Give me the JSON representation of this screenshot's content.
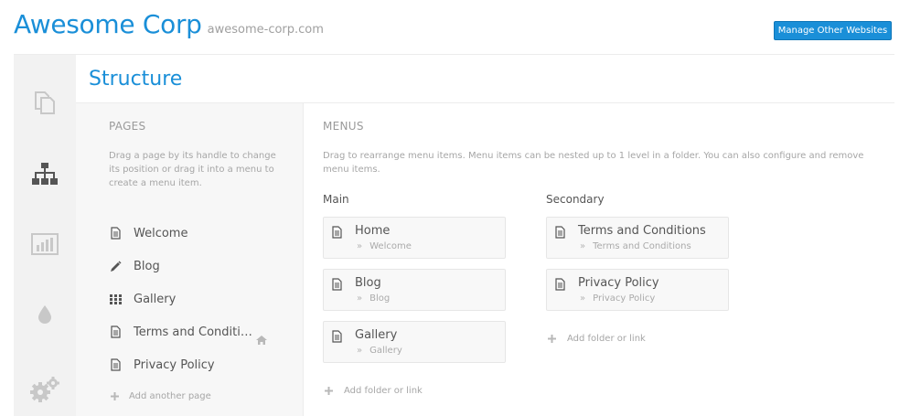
{
  "header": {
    "brand_title": "Awesome Corp",
    "brand_domain": "awesome-corp.com",
    "manage_button": "Manage Other Websites"
  },
  "colors": {
    "accent": "#1a8fd8",
    "sidebar_bg": "#f2f2f2",
    "icon": "#c8c8c8",
    "active_icon": "#555555"
  },
  "sidebar": {
    "items": [
      {
        "icon": "pages-icon",
        "active": false
      },
      {
        "icon": "sitemap-icon",
        "active": true
      },
      {
        "icon": "stats-icon",
        "active": false
      },
      {
        "icon": "droplet-icon",
        "active": false
      },
      {
        "icon": "gears-icon",
        "active": false
      }
    ]
  },
  "main": {
    "title": "Structure"
  },
  "pages": {
    "heading": "PAGES",
    "hint": "Drag a page by its handle to change its position or drag it into a menu to create a menu item.",
    "items": [
      {
        "label": "Welcome",
        "icon": "document-icon",
        "is_home": true
      },
      {
        "label": "Blog",
        "icon": "pencil-icon"
      },
      {
        "label": "Gallery",
        "icon": "grid-icon"
      },
      {
        "label": "Terms and Conditi…",
        "icon": "document-icon"
      },
      {
        "label": "Privacy Policy",
        "icon": "document-icon"
      }
    ],
    "add_label": "Add another page"
  },
  "menus": {
    "heading": "MENUS",
    "hint": "Drag to rearrange menu items. Menu items can be nested up to 1 level in a folder. You can also configure and remove menu items.",
    "main": {
      "label": "Main",
      "items": [
        {
          "title": "Home",
          "target": "Welcome"
        },
        {
          "title": "Blog",
          "target": "Blog"
        },
        {
          "title": "Gallery",
          "target": "Gallery"
        }
      ],
      "add_label": "Add folder or link"
    },
    "secondary": {
      "label": "Secondary",
      "items": [
        {
          "title": "Terms and Conditions",
          "target": "Terms and Conditions"
        },
        {
          "title": "Privacy Policy",
          "target": "Privacy Policy"
        }
      ],
      "add_label": "Add folder or link"
    }
  }
}
